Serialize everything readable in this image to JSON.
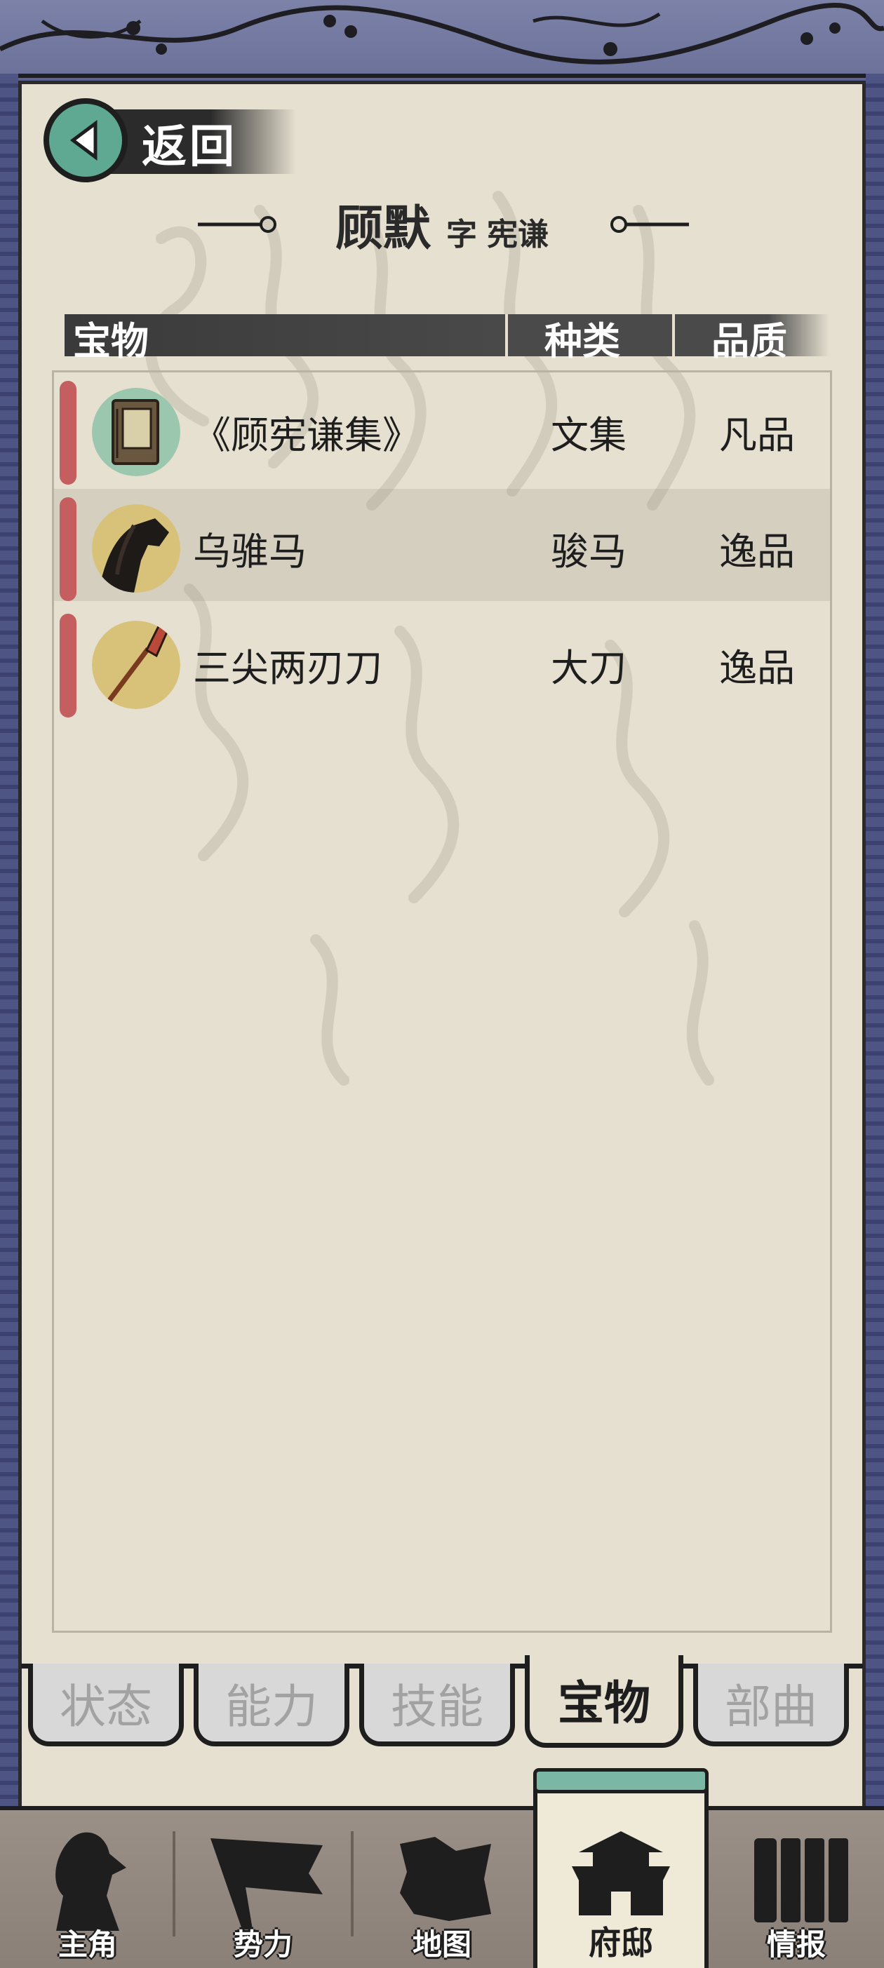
{
  "back": {
    "label": "返回"
  },
  "title": {
    "name": "顾默",
    "zi_prefix": "字",
    "styled_name": "宪谦"
  },
  "table": {
    "headers": {
      "item": "宝物",
      "type": "种类",
      "grade": "品质"
    },
    "rows": [
      {
        "name": "《顾宪谦集》",
        "type": "文集",
        "grade": "凡品",
        "icon": "book-icon"
      },
      {
        "name": "乌骓马",
        "type": "骏马",
        "grade": "逸品",
        "icon": "horse-icon"
      },
      {
        "name": "三尖两刃刀",
        "type": "大刀",
        "grade": "逸品",
        "icon": "blade-icon"
      }
    ]
  },
  "tabs": [
    {
      "label": "状态",
      "active": false
    },
    {
      "label": "能力",
      "active": false
    },
    {
      "label": "技能",
      "active": false
    },
    {
      "label": "宝物",
      "active": true
    },
    {
      "label": "部曲",
      "active": false
    }
  ],
  "bottom_nav": [
    {
      "label": "主角",
      "icon": "hero-icon"
    },
    {
      "label": "势力",
      "icon": "banner-icon"
    },
    {
      "label": "地图",
      "icon": "map-icon"
    },
    {
      "label": "府邸",
      "icon": "mansion-icon",
      "active": true
    },
    {
      "label": "情报",
      "icon": "scroll-icon"
    }
  ],
  "colors": {
    "accent_teal": "#5fa891",
    "row_marker": "#c55e5e",
    "paper": "#e6e0d0",
    "border": "#5b6190"
  }
}
